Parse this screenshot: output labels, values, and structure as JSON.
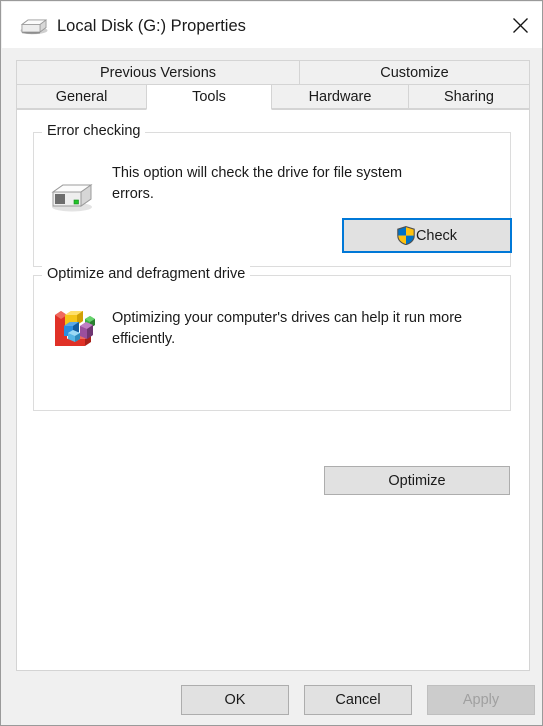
{
  "window": {
    "title": "Local Disk (G:) Properties",
    "drive_icon": "hard-disk-icon",
    "close_icon": "close-icon"
  },
  "tabs": {
    "row1": [
      {
        "label": "Previous Versions",
        "selected": false
      },
      {
        "label": "Customize",
        "selected": false
      }
    ],
    "row2": [
      {
        "label": "General",
        "selected": false
      },
      {
        "label": "Tools",
        "selected": true
      },
      {
        "label": "Hardware",
        "selected": false
      },
      {
        "label": "Sharing",
        "selected": false
      }
    ]
  },
  "groups": {
    "error_checking": {
      "label": "Error checking",
      "icon": "hard-disk-icon",
      "description": "This option will check the drive for file system errors.",
      "button": {
        "label": "Check",
        "icon": "uac-shield-icon",
        "focused": true,
        "enabled": true
      }
    },
    "optimize": {
      "label": "Optimize and defragment drive",
      "icon": "defragment-blocks-icon",
      "description": "Optimizing your computer's drives can help it run more efficiently.",
      "button": {
        "label": "Optimize",
        "enabled": true
      }
    }
  },
  "footer": {
    "ok": "OK",
    "cancel": "Cancel",
    "apply": "Apply",
    "apply_enabled": false
  },
  "colors": {
    "accent": "#0078d7",
    "shield_blue": "#0072c6",
    "shield_yellow": "#ffc20e",
    "dialog_bg": "#f0f0f0",
    "panel_bg": "#ffffff",
    "button_face": "#e1e1e1",
    "disabled_text": "#a0a0a0"
  }
}
